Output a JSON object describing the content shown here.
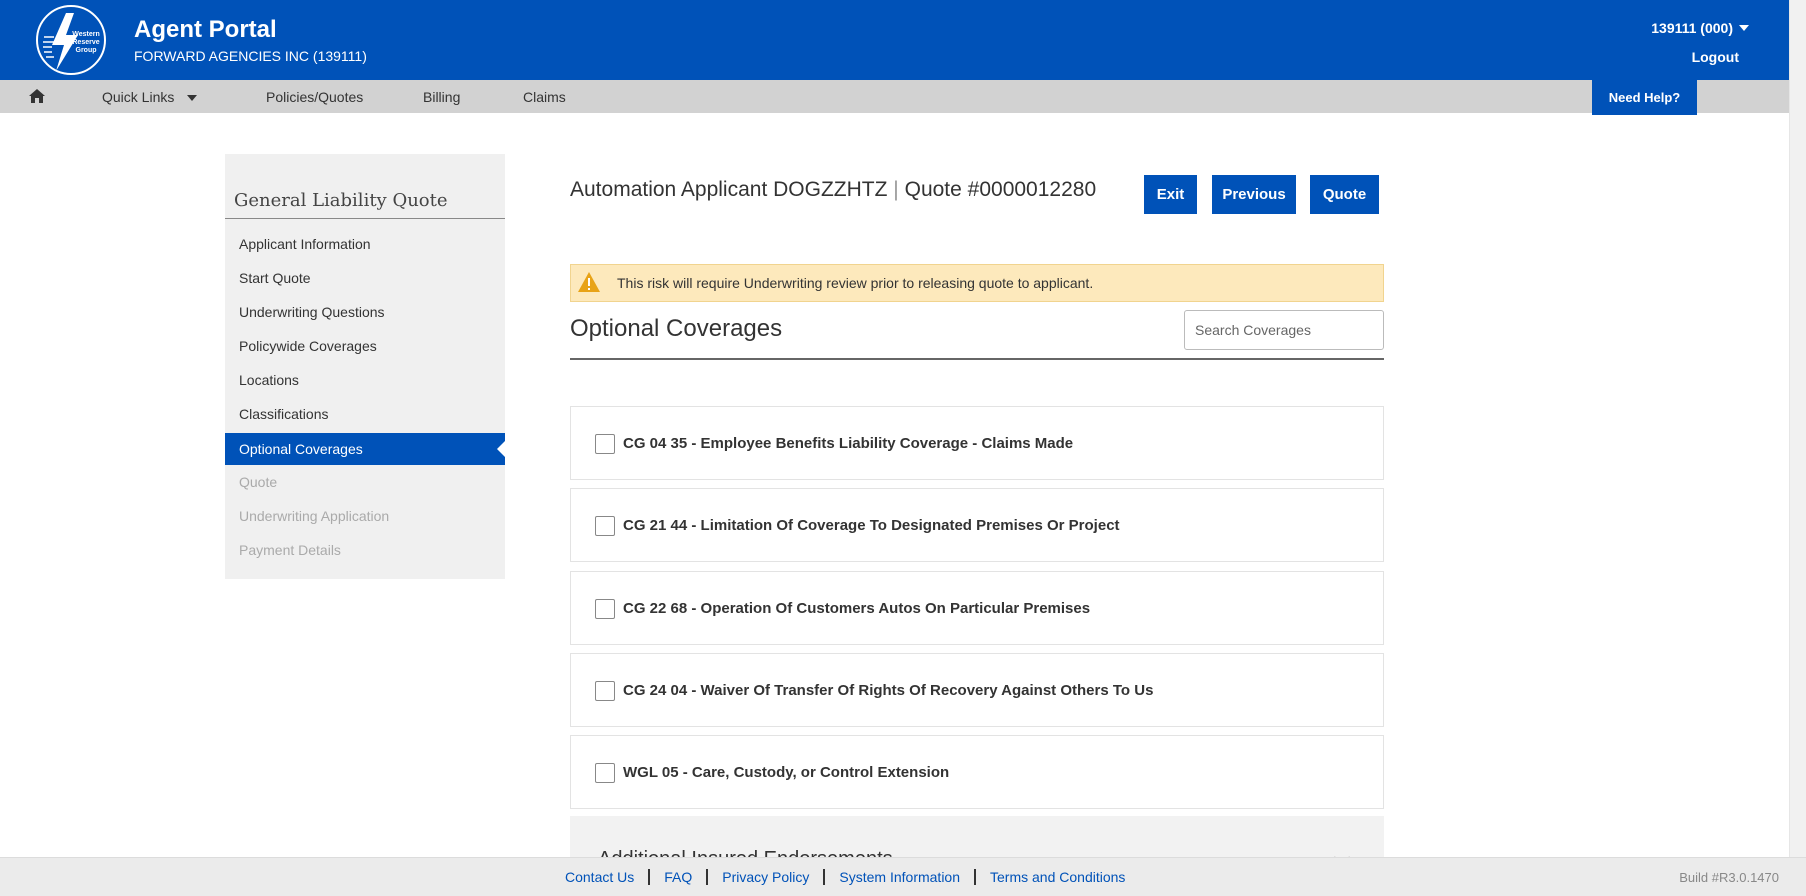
{
  "header": {
    "logo_text": "Western Reserve Group",
    "app_title": "Agent Portal",
    "agency": "FORWARD AGENCIES INC (139111)",
    "account": "139111 (000)",
    "logout": "Logout"
  },
  "nav": {
    "quick_links": "Quick Links",
    "policies": "Policies/Quotes",
    "billing": "Billing",
    "claims": "Claims",
    "need_help": "Need Help?"
  },
  "sidebar": {
    "title": "General Liability Quote",
    "items": [
      {
        "label": "Applicant Information"
      },
      {
        "label": "Start Quote"
      },
      {
        "label": "Underwriting Questions"
      },
      {
        "label": "Policywide Coverages"
      },
      {
        "label": "Locations"
      },
      {
        "label": "Classifications"
      },
      {
        "label": "Optional Coverages"
      },
      {
        "label": "Quote"
      },
      {
        "label": "Underwriting Application"
      },
      {
        "label": "Payment Details"
      }
    ]
  },
  "main": {
    "applicant": "Automation Applicant DOGZZHTZ",
    "separator": "|",
    "quote_number": "Quote #0000012280",
    "buttons": {
      "exit": "Exit",
      "previous": "Previous",
      "quote": "Quote"
    },
    "warning": "This risk will require Underwriting review prior to releasing quote to applicant.",
    "section_title": "Optional Coverages",
    "search_placeholder": "Search Coverages",
    "coverages": [
      {
        "label": "CG 04 35 - Employee Benefits Liability Coverage - Claims Made",
        "checked": false
      },
      {
        "label": "CG 21 44 - Limitation Of Coverage To Designated Premises Or Project",
        "checked": false
      },
      {
        "label": "CG 22 68 - Operation Of Customers Autos On Particular Premises",
        "checked": false
      },
      {
        "label": "CG 24 04 - Waiver Of Transfer Of Rights Of Recovery Against Others To Us",
        "checked": false
      },
      {
        "label": "WGL 05 - Care, Custody, or Control Extension",
        "checked": false
      }
    ],
    "additional_section": "Additional Insured Endorsements"
  },
  "footer": {
    "links": [
      "Contact Us",
      "FAQ",
      "Privacy Policy",
      "System Information",
      "Terms and Conditions"
    ],
    "build": "Build #R3.0.1470"
  },
  "colors": {
    "brand": "#0052b8",
    "warning_bg": "#fde9bc",
    "warning_icon": "#e8a317"
  }
}
